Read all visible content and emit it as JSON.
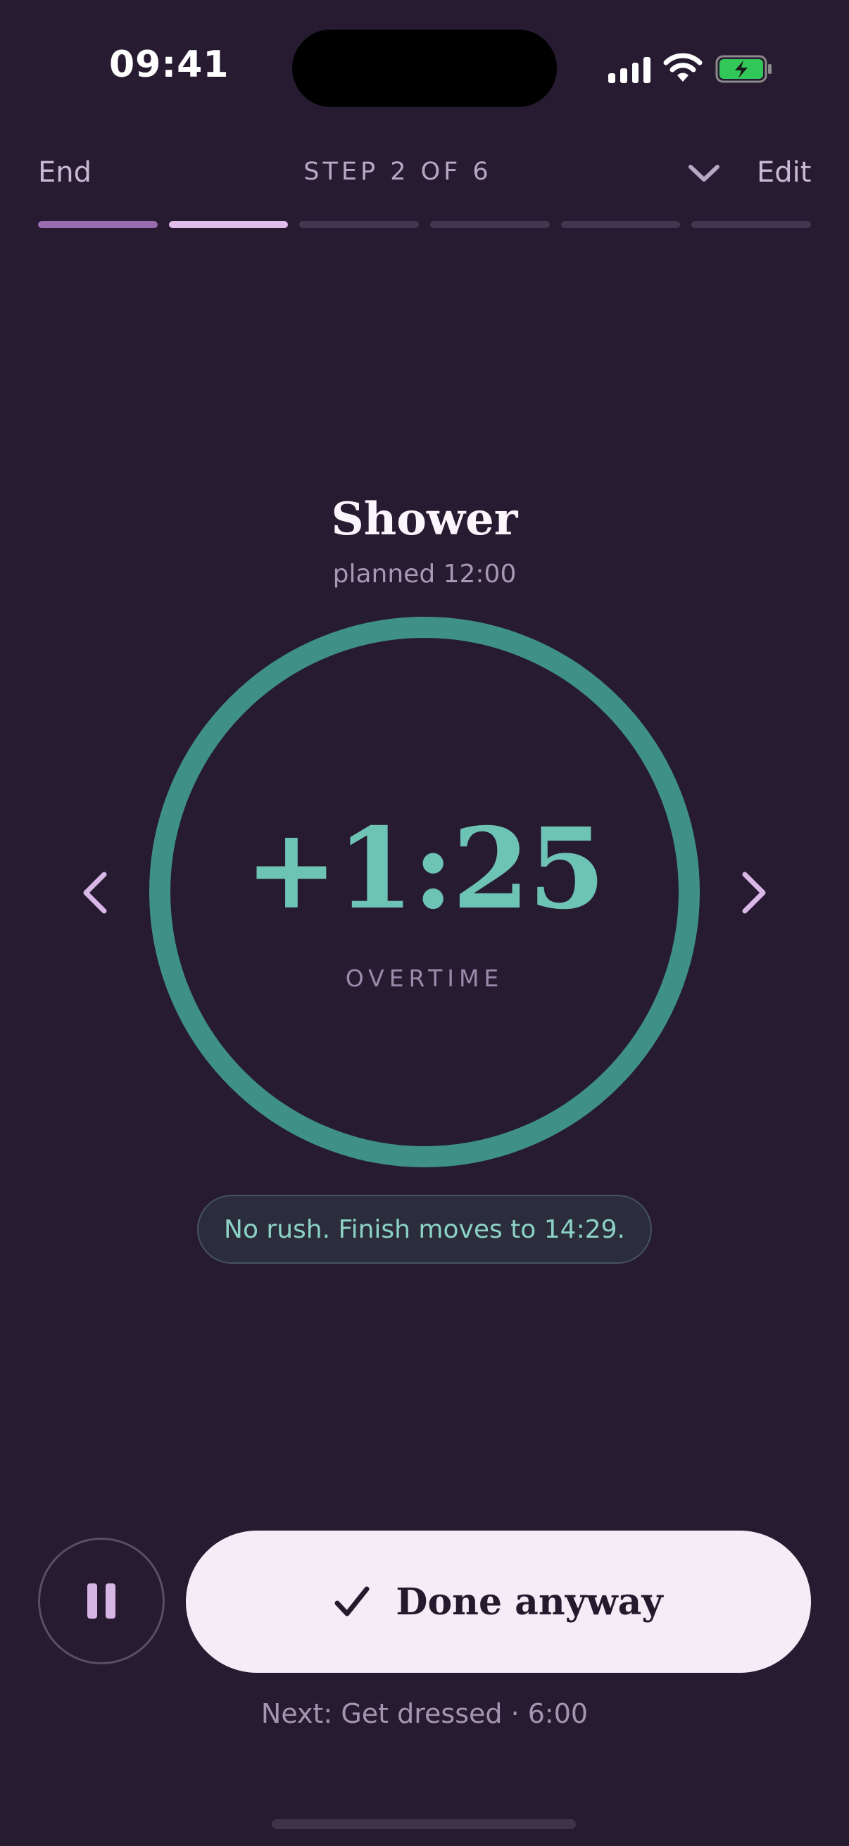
{
  "status_bar": {
    "time": "09:41",
    "icons": [
      "signal-icon",
      "wifi-icon",
      "battery-charging-icon"
    ]
  },
  "header": {
    "end_label": "End",
    "step_label": "STEP 2 OF 6",
    "chevron_icon": "chevron-down-icon",
    "edit_label": "Edit",
    "progress": {
      "total_steps": 6,
      "current_step": 2
    }
  },
  "step": {
    "title": "Shower",
    "planned": "planned 12:00"
  },
  "timer": {
    "value": "+1:25",
    "label": "OVERTIME",
    "ring_color": "#3F9187"
  },
  "nav": {
    "prev_icon": "chevron-left-icon",
    "next_icon": "chevron-right-icon"
  },
  "toast": {
    "text": "No rush. Finish moves to 14:29."
  },
  "controls": {
    "pause_icon": "pause-icon",
    "done_icon": "checkmark-icon",
    "done_label": "Done anyway"
  },
  "next_hint": "Next: Get dressed · 6:00",
  "colors": {
    "background": "#271B31",
    "accent_teal": "#6EC4B4",
    "progress_done": "#9A6BB0",
    "progress_current": "#E0BDEB",
    "progress_pending": "#433650",
    "button_bg": "#F5ECF7"
  }
}
